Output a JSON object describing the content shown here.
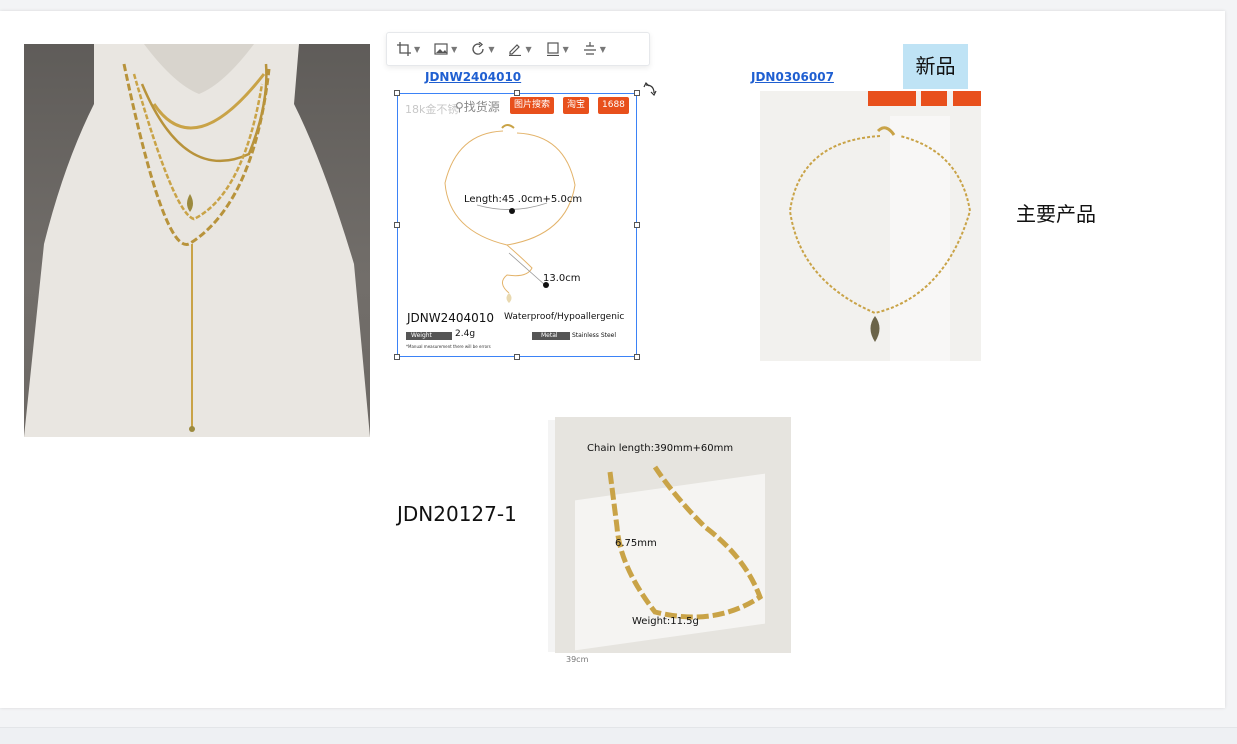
{
  "toolbar": {
    "tools": [
      {
        "name": "crop"
      },
      {
        "name": "image"
      },
      {
        "name": "rotate"
      },
      {
        "name": "edit"
      },
      {
        "name": "border"
      },
      {
        "name": "align"
      }
    ]
  },
  "products": {
    "link1": "JDNW2404010",
    "link2": "JDN0306007",
    "new_tag": "新品",
    "main_label": "主要产品",
    "code3": "JDN20127-1"
  },
  "image1": {
    "search_label": "找货源",
    "overlay_text": "18k金不锈",
    "badges": [
      "图片搜索",
      "淘宝",
      "1688"
    ],
    "length_label": "Length:45 .0cm+5.0cm",
    "drop_label": "13.0cm",
    "model": "JDNW2404010",
    "feature": "Waterproof/Hypoallergenic",
    "weight_key": "Weight",
    "weight_value": "2.4g",
    "metal_key": "Metal",
    "metal_value": "Stainless Steel",
    "note": "*Manual measurement there will be errors"
  },
  "image3": {
    "chain_length": "Chain length:390mm+60mm",
    "width_label": "6.75mm",
    "weight_label": "Weight:11.5g",
    "bottom_cut": "39cm"
  },
  "colors": {
    "link": "#1f5fd1",
    "badge": "#e8501c",
    "selection": "#3b82f6",
    "new_tag_bg": "#bfe3f5"
  }
}
